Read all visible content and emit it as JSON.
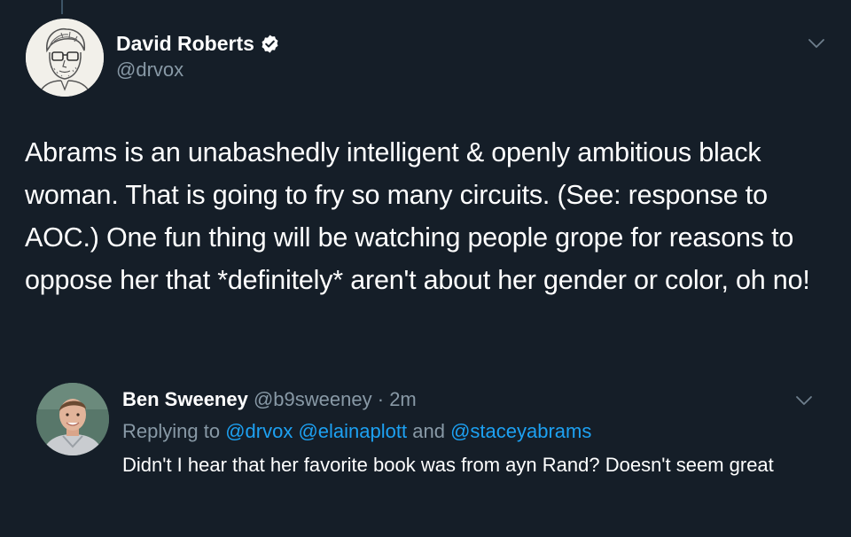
{
  "colors": {
    "background": "#151e28",
    "text_primary": "#ffffff",
    "text_secondary": "#8899a6",
    "link": "#1da1f2",
    "verified_badge": "#ffffff"
  },
  "main_tweet": {
    "author": {
      "display_name": "David Roberts",
      "handle": "@drvox",
      "verified": true,
      "avatar_icon": "sketch-portrait-avatar"
    },
    "menu_icon": "chevron-down-icon",
    "text": "Abrams is an unabashedly intelligent & openly ambitious black woman. That is going to fry so many circuits. (See: response to AOC.) One fun thing will be watching people grope for reasons to oppose her that *definitely* aren't about her gender or color, oh no!"
  },
  "reply": {
    "author": {
      "display_name": "Ben Sweeney",
      "handle": "@b9sweeney",
      "avatar_icon": "photo-avatar"
    },
    "separator": "·",
    "time": "2m",
    "replying_to": {
      "prefix": "Replying to",
      "mentions": [
        "@drvox",
        "@elainaplott",
        "@staceyabrams"
      ],
      "conjunction": "and"
    },
    "menu_icon": "chevron-down-icon",
    "text": "Didn't I hear that her favorite book was from ayn Rand? Doesn't seem great"
  }
}
